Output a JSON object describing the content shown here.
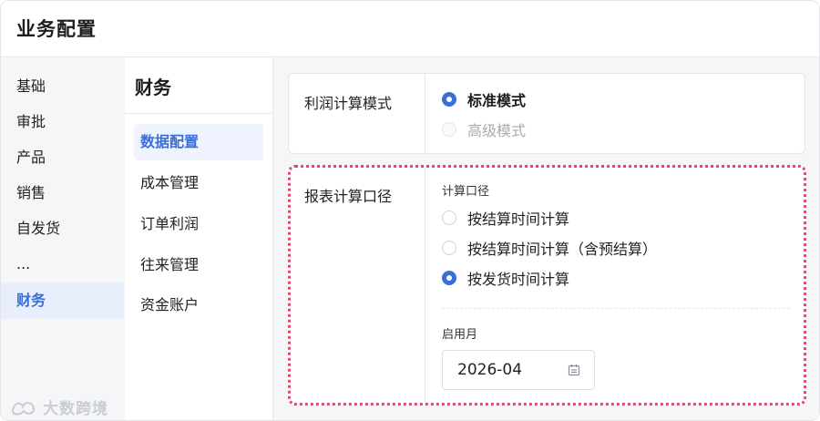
{
  "page": {
    "title": "业务配置"
  },
  "sidebar": {
    "items": [
      {
        "label": "基础"
      },
      {
        "label": "审批"
      },
      {
        "label": "产品"
      },
      {
        "label": "销售"
      },
      {
        "label": "自发货"
      },
      {
        "label": "..."
      },
      {
        "label": "财务",
        "active": true
      }
    ]
  },
  "subnav": {
    "title": "财务",
    "items": [
      {
        "label": "数据配置",
        "active": true
      },
      {
        "label": "成本管理"
      },
      {
        "label": "订单利润"
      },
      {
        "label": "往来管理"
      },
      {
        "label": "资金账户"
      }
    ]
  },
  "profit_mode": {
    "label": "利润计算模式",
    "options": [
      {
        "label": "标准模式",
        "checked": true
      },
      {
        "label": "高级模式",
        "disabled": true
      }
    ]
  },
  "report_basis": {
    "label": "报表计算口径",
    "sublabel": "计算口径",
    "options": [
      {
        "label": "按结算时间计算",
        "checked": false
      },
      {
        "label": "按结算时间计算（含预结算）",
        "checked": false
      },
      {
        "label": "按发货时间计算",
        "checked": true
      }
    ],
    "start_month": {
      "label": "启用月",
      "value": "2026-04"
    }
  },
  "watermark": {
    "text": "大数跨境"
  },
  "colors": {
    "accent": "#3a6fd8",
    "highlight_border": "#e8466f"
  }
}
